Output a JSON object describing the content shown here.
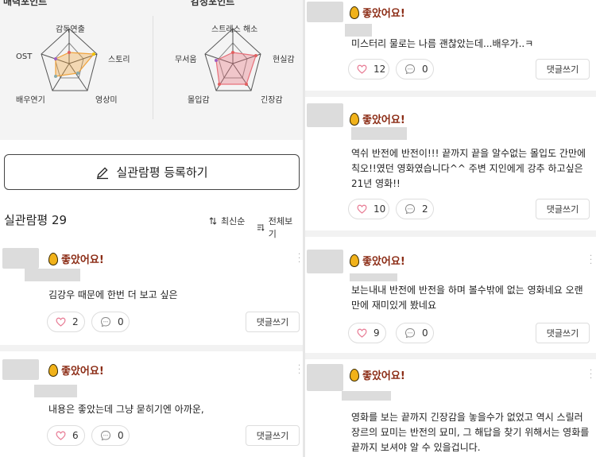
{
  "radar": {
    "charm_title": "매력포인트",
    "emotion_title": "감정포인트",
    "charm_axes": [
      "감독연출",
      "스토리",
      "영상미",
      "배우연기",
      "OST"
    ],
    "emotion_axes": [
      "스트레스 해소",
      "현실감",
      "긴장감",
      "몰입감",
      "무서움"
    ],
    "accent_color": "#e8707a",
    "charm_color": "#f0a23a"
  },
  "write_review": {
    "label": "실관람평 등록하기",
    "icon": "pencil-icon"
  },
  "list": {
    "title": "실관람평 29",
    "sort_label": "최신순",
    "filter_label": "전체보기"
  },
  "badge_label": "좋았어요!",
  "reply_label": "댓글쓰기",
  "reviews_left": [
    {
      "text": "김강우 때문에 한번 더 보고 싶은",
      "likes": "2",
      "comments": "0"
    },
    {
      "text": "내용은 좋았는데 그냥 묻히기엔 아까운,",
      "likes": "6",
      "comments": "0"
    }
  ],
  "reviews_right": [
    {
      "text": "미스터리 물로는 나름 괜찮았는데...배우가..ㅋ",
      "likes": "12",
      "comments": "0"
    },
    {
      "text": "역쉬 반전에 반전이!!! 끝까지 끝을 알수없는 몰입도 간만에 칙오!!였던 영화였습니다^^ 주변 지인에게 강추 하고싶은 21년 영화!!",
      "likes": "10",
      "comments": "2"
    },
    {
      "text": "보는내내 반전에 반전을 하며 볼수밖에 없는 영화네요 오랜만에 재미있게 봤네요",
      "likes": "9",
      "comments": "0"
    },
    {
      "text": "영화를 보는 끝까지 긴장감을 놓을수가 없었고 역시 스릴러 장르의 묘미는 반전의 묘미, 그 해답을 찾기 위해서는 영화를 끝까지 보셔야 알 수 있을겁니다.",
      "likes": "",
      "comments": ""
    }
  ]
}
